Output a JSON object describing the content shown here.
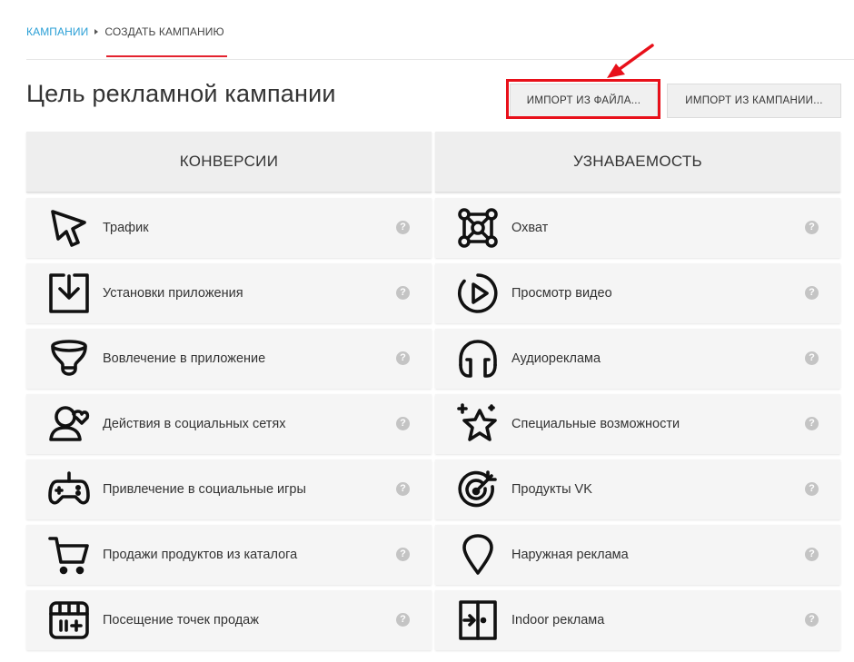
{
  "breadcrumb": {
    "link": "КАМПАНИИ",
    "current": "СОЗДАТЬ КАМПАНИЮ"
  },
  "page_title": "Цель рекламной кампании",
  "buttons": {
    "import_file": "ИМПОРТ ИЗ ФАЙЛА...",
    "import_campaign": "ИМПОРТ ИЗ КАМПАНИИ..."
  },
  "help_glyph": "?",
  "columns": [
    {
      "header": "КОНВЕРСИИ",
      "items": [
        {
          "label": "Трафик",
          "icon": "cursor-click-icon"
        },
        {
          "label": "Установки приложения",
          "icon": "download-box-icon"
        },
        {
          "label": "Вовлечение в приложение",
          "icon": "funnel-icon"
        },
        {
          "label": "Действия в социальных сетях",
          "icon": "social-person-icon"
        },
        {
          "label": "Привлечение в социальные игры",
          "icon": "gamepad-icon"
        },
        {
          "label": "Продажи продуктов из каталога",
          "icon": "cart-icon"
        },
        {
          "label": "Посещение точек продаж",
          "icon": "store-icon"
        }
      ]
    },
    {
      "header": "УЗНАВАЕМОСТЬ",
      "items": [
        {
          "label": "Охват",
          "icon": "network-reach-icon"
        },
        {
          "label": "Просмотр видео",
          "icon": "play-circle-icon"
        },
        {
          "label": "Аудиореклама",
          "icon": "headphones-icon"
        },
        {
          "label": "Специальные возможности",
          "icon": "star-sparkle-icon"
        },
        {
          "label": "Продукты VK",
          "icon": "target-icon"
        },
        {
          "label": "Наружная реклама",
          "icon": "map-pin-icon"
        },
        {
          "label": "Indoor реклама",
          "icon": "door-enter-icon"
        }
      ]
    }
  ],
  "colors": {
    "accent_link": "#2a9fd6",
    "accent_red": "#e4232f",
    "highlight": "#e8101a"
  }
}
